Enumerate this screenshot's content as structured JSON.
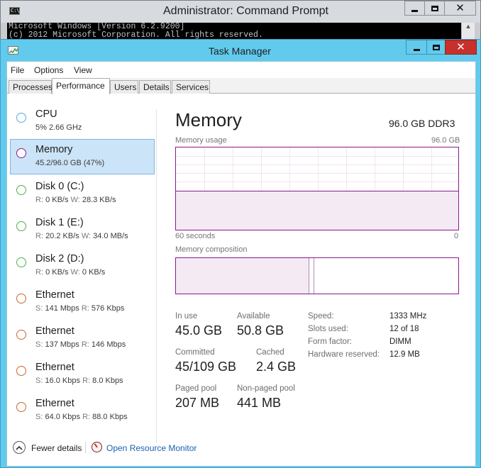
{
  "cmd": {
    "title": "Administrator: Command Prompt",
    "icon_text": "C:\\",
    "lines": [
      "Microsoft Windows [Version 6.2.9200]",
      "(c) 2012 Microsoft Corporation. All rights reserved."
    ],
    "scroll_glyph": "▲"
  },
  "task_manager": {
    "title": "Task Manager",
    "menu": [
      "File",
      "Options",
      "View"
    ],
    "tabs": [
      "Processes",
      "Performance",
      "Users",
      "Details",
      "Services"
    ],
    "active_tab": "Performance",
    "resources": [
      {
        "name": "CPU",
        "detail": "5%  2.66 GHz",
        "dot_color": "#5aa7d8"
      },
      {
        "name": "Memory",
        "detail": "45.2/96.0 GB (47%)",
        "dot_color": "#8b1a8b",
        "selected": true
      },
      {
        "name": "Disk 0 (C:)",
        "detail_r_label": "R:",
        "detail_r": "0 KB/s",
        "detail_w_label": "W:",
        "detail_w": "28.3 KB/s",
        "dot_color": "#4caf50"
      },
      {
        "name": "Disk 1 (E:)",
        "detail_r_label": "R:",
        "detail_r": "20.2 KB/s",
        "detail_w_label": "W:",
        "detail_w": "34.0 MB/s",
        "dot_color": "#4caf50"
      },
      {
        "name": "Disk 2 (D:)",
        "detail_r_label": "R:",
        "detail_r": "0 KB/s",
        "detail_w_label": "W:",
        "detail_w": "0 KB/s",
        "dot_color": "#4caf50"
      },
      {
        "name": "Ethernet",
        "detail_s_label": "S:",
        "detail_s": "141 Mbps",
        "detail_rr_label": "R:",
        "detail_rr": "576 Kbps",
        "dot_color": "#c8692c"
      },
      {
        "name": "Ethernet",
        "detail_s_label": "S:",
        "detail_s": "137 Mbps",
        "detail_rr_label": "R:",
        "detail_rr": "146 Mbps",
        "dot_color": "#c8692c"
      },
      {
        "name": "Ethernet",
        "detail_s_label": "S:",
        "detail_s": "16.0 Kbps",
        "detail_rr_label": "R:",
        "detail_rr": "8.0 Kbps",
        "dot_color": "#c8692c"
      },
      {
        "name": "Ethernet",
        "detail_s_label": "S:",
        "detail_s": "64.0 Kbps",
        "detail_rr_label": "R:",
        "detail_rr": "88.0 Kbps",
        "dot_color": "#c8692c"
      }
    ],
    "memory": {
      "title": "Memory",
      "spec": "96.0 GB DDR3",
      "usage_label": "Memory usage",
      "usage_max": "96.0 GB",
      "graph_left": "60 seconds",
      "graph_right": "0",
      "usage_fraction": 0.47,
      "composition_label": "Memory composition",
      "composition_in_use_fraction": 0.47,
      "composition_modified_fraction": 0.02,
      "stats": {
        "in_use_label": "In use",
        "in_use": "45.0 GB",
        "available_label": "Available",
        "available": "50.8 GB",
        "committed_label": "Committed",
        "committed": "45/109 GB",
        "cached_label": "Cached",
        "cached": "2.4 GB",
        "paged_label": "Paged pool",
        "paged": "207 MB",
        "nonpaged_label": "Non-paged pool",
        "nonpaged": "441 MB"
      },
      "specs": {
        "speed_label": "Speed:",
        "speed": "1333 MHz",
        "slots_label": "Slots used:",
        "slots": "12 of 18",
        "form_label": "Form factor:",
        "form": "DIMM",
        "reserved_label": "Hardware reserved:",
        "reserved": "12.9 MB"
      },
      "accent_color": "#8b1a8b"
    },
    "footer": {
      "fewer_details": "Fewer details",
      "open_resource_monitor": "Open Resource Monitor"
    }
  }
}
